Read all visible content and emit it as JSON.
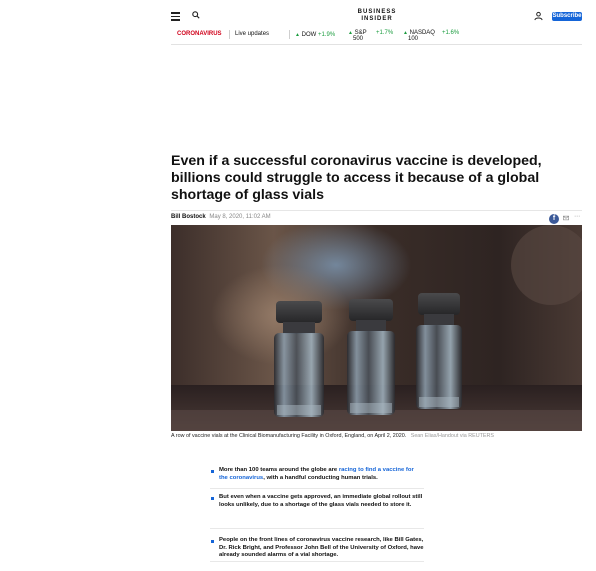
{
  "header": {
    "logo_line1": "BUSINESS",
    "logo_line2": "INSIDER",
    "subscribe_label": "Subscribe",
    "menu_icon": "hamburger-icon",
    "search_icon": "search-icon",
    "user_icon": "user-icon"
  },
  "ticker": {
    "section": "CORONAVIRUS",
    "live": "Live updates",
    "markets": [
      {
        "name": "DOW",
        "change": "+1.9%"
      },
      {
        "name_line1": "S&P",
        "name_line2": "500",
        "change": "+1.7%"
      },
      {
        "name_line1": "NASDAQ",
        "name_line2": "100",
        "change": "+1.6%"
      }
    ]
  },
  "article": {
    "headline": "Even if a successful coronavirus vaccine is developed, billions could struggle to access it because of a global shortage of glass vials",
    "author": "Bill Bostock",
    "date": "May 8, 2020, 11:02 AM",
    "caption": "A row of vaccine vials at the Clinical Biomanufacturing Facility in Oxford, England, on April 2, 2020.",
    "credit": "Sean Elias/Handout via REUTERS",
    "bullets": [
      {
        "pre": "More than 100 teams around the globe are ",
        "link": "racing to find a vaccine for the coronavirus",
        "post": ", with a handful conducting human trials."
      },
      {
        "text": "But even when a vaccine gets approved, an immediate global rollout still looks unlikely, due to a shortage of the glass vials needed to store it."
      },
      {
        "text": "People on the front lines of coronavirus vaccine research, like Bill Gates, Dr. Rick Bright, and Professor John Bell of the University of Oxford, have already sounded alarms of a vial shortage."
      }
    ]
  },
  "colors": {
    "brand_blue": "#1565d8",
    "section_red": "#d0021b",
    "market_up": "#1a9c3e",
    "facebook": "#3b5998"
  }
}
